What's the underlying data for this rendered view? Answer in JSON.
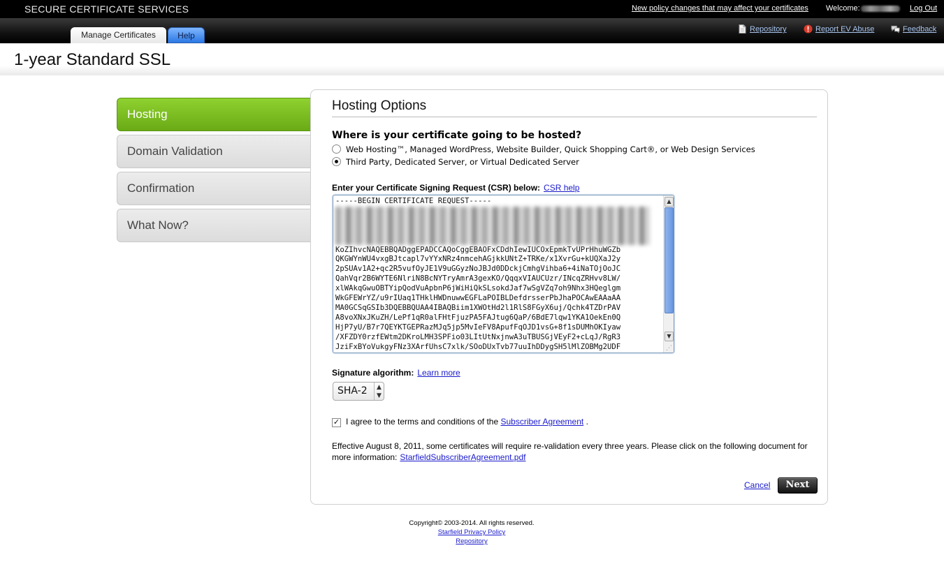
{
  "topbar": {
    "brand": "SECURE CERTIFICATE SERVICES",
    "policy_link": "New policy changes that may affect your certificates",
    "welcome_label": "Welcome:",
    "logout": "Log Out"
  },
  "nav": {
    "tabs": [
      {
        "label": "Manage Certificates"
      },
      {
        "label": "Help"
      }
    ],
    "links": {
      "repository": "Repository",
      "report_ev": "Report EV Abuse",
      "feedback": "Feedback"
    }
  },
  "page": {
    "title": "1-year Standard SSL"
  },
  "steps": [
    {
      "label": "Hosting",
      "active": true
    },
    {
      "label": "Domain Validation",
      "active": false
    },
    {
      "label": "Confirmation",
      "active": false
    },
    {
      "label": "What Now?",
      "active": false
    }
  ],
  "panel": {
    "title": "Hosting Options",
    "question": "Where is your certificate going to be hosted?",
    "options": [
      {
        "label": "Web Hosting™, Managed WordPress, Website Builder, Quick Shopping Cart®, or Web Design Services",
        "selected": false
      },
      {
        "label": "Third Party, Dedicated Server, or Virtual Dedicated Server",
        "selected": true
      }
    ],
    "csr_label": "Enter your Certificate Signing Request (CSR) below:",
    "csr_help": "CSR help",
    "csr_value": "-----BEGIN CERTIFICATE REQUEST-----\n\n\n\n\nKoZIhvcNAQEBBQADggEPADCCAQoCggEBAOFxCDdhIewIUCOxEpmkTvUPrHhuWGZb\nQKGWYnWU4vxgBJtcapl7vYYxNRz4nmcehAGjkkUNtZ+TRKe/x1XvrGu+kUQXaJ2y\n2pSUAv1A2+qc2R5vufOyJE1V9uGGyzNoJBJd0DDckjCmhgVihba6+4iNaTOjOoJC\nQahVqr2B6WYTE6NlriN8BcNYTryAmrA3gexKO/QqqxVIAUCUzr/INcqZRHvv8LW/\nxlWAkqGwuOBTYipQodVuApbnP6jWiHiQkSLsokdJaf7wSgVZq7oh9Nhx3HQeglgm\nWkGFEWrYZ/u9rIUaq1THklHWDnuwwEGFLaPOIBLDefdrsserPbJhaPOCAwEAAaAA\nMA0GCSqGSIb3DQEBBQUAA4IBAQBiim1XWOtHd2l1RlS8FGyX6uj/Qchk4TZDrPAV\nA8voXNxJKuZH/LePf1qR0alFHtFjuzPA5FAJtug6QaP/6BdE7lqw1YKA1OekEn0Q\nHjP7yU/B7r7QEYKTGEPRazMJq5jp5MvIeFV8ApufFqOJD1vsG+8f1sDUMhOKIyaw\n/XFZDY0rzfEWtm2DKroLMH3SPFio03LItUtNxjnwA3uTBUSGjVEyF2+cLqJ/RgR3\nJziFxBYoVukgyFNz3XArfUhsC7xlk/SOoDUxTvb77uuIhDDygSH5lMlZOBMg2UDF",
    "sig_label": "Signature algorithm:",
    "sig_learn_more": "Learn more",
    "sig_value": "SHA-2",
    "agree_text": "I agree to the terms and conditions of the",
    "agree_link": "Subscriber Agreement",
    "agree_end": ".",
    "agree_checked": true,
    "effective_text": "Effective August 8, 2011, some certificates will require re-validation every three years. Please click on the following document for more information:",
    "effective_link": "StarfieldSubscriberAgreement.pdf",
    "cancel": "Cancel",
    "next": "Next"
  },
  "footer": {
    "copyright": "Copyright© 2003-2014. All rights reserved.",
    "privacy": "Starfield Privacy Policy",
    "repository": "Repository"
  },
  "colors": {
    "active_step": "#78b91f",
    "link": "#1a1acc",
    "help_tab": "#2b78e4"
  }
}
